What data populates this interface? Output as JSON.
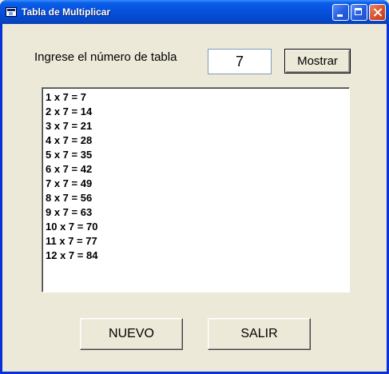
{
  "window": {
    "title": "Tabla de Multiplicar"
  },
  "form": {
    "prompt_label": "Ingrese el número de tabla",
    "number_value": "7",
    "show_button": "Mostrar"
  },
  "results": [
    "1 x 7 = 7",
    "2 x 7 = 14",
    "3 x 7 = 21",
    "4 x 7 = 28",
    "5 x 7 = 35",
    "6 x 7 = 42",
    "7 x 7 = 49",
    "8 x 7 = 56",
    "9 x 7 = 63",
    "10 x 7 = 70",
    "11 x 7 = 77",
    "12 x 7 = 84"
  ],
  "actions": {
    "new_button": "NUEVO",
    "exit_button": "SALIR"
  },
  "icons": {
    "app": "app-window-icon",
    "minimize": "minimize-icon",
    "maximize": "maximize-icon",
    "close": "close-icon"
  }
}
